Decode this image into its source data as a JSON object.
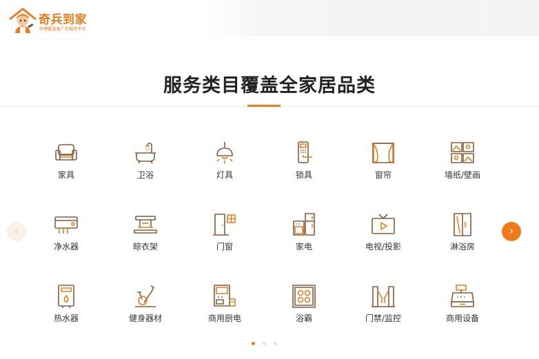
{
  "brand": {
    "name": "奇兵到家",
    "slogan": "师傅覆盖更广的服务平台",
    "accent_color": "#ef7a1a"
  },
  "section": {
    "title": "服务类目覆盖全家居品类"
  },
  "categories": [
    {
      "label": "家具",
      "icon": "sofa-icon"
    },
    {
      "label": "卫浴",
      "icon": "bathtub-icon"
    },
    {
      "label": "灯具",
      "icon": "pendant-lamp-icon"
    },
    {
      "label": "锁具",
      "icon": "door-lock-icon"
    },
    {
      "label": "窗帘",
      "icon": "curtain-icon"
    },
    {
      "label": "墙纸/壁画",
      "icon": "wall-painting-icon"
    },
    {
      "label": "净水器",
      "icon": "water-purifier-icon"
    },
    {
      "label": "晾衣架",
      "icon": "clothes-rack-icon"
    },
    {
      "label": "门窗",
      "icon": "door-window-icon"
    },
    {
      "label": "家电",
      "icon": "appliance-icon"
    },
    {
      "label": "电视/投影",
      "icon": "tv-icon"
    },
    {
      "label": "淋浴房",
      "icon": "shower-room-icon"
    },
    {
      "label": "热水器",
      "icon": "water-heater-icon"
    },
    {
      "label": "健身器材",
      "icon": "exercise-bike-icon"
    },
    {
      "label": "商用厨电",
      "icon": "commercial-kitchen-icon"
    },
    {
      "label": "浴霸",
      "icon": "bath-heater-icon"
    },
    {
      "label": "门禁/监控",
      "icon": "access-gate-icon"
    },
    {
      "label": "商用设备",
      "icon": "cash-register-icon"
    }
  ],
  "carousel": {
    "prev_icon": "chevron-left-icon",
    "next_icon": "chevron-right-icon",
    "prev_glyph": "‹",
    "next_glyph": "›",
    "page_count": 3,
    "active_page": 1
  }
}
